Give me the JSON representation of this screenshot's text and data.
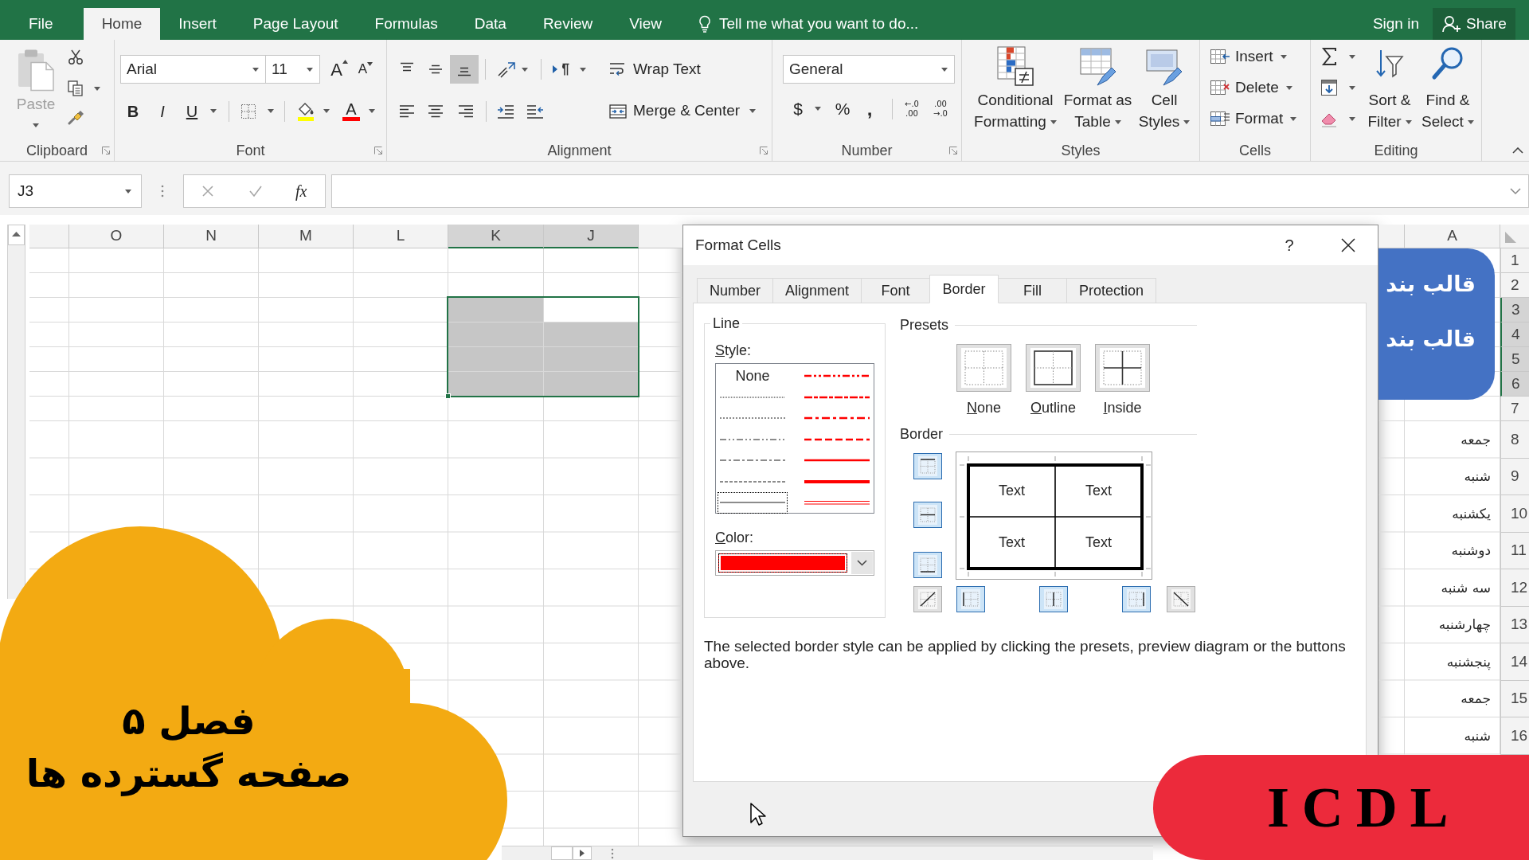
{
  "tabs": [
    {
      "label": "File",
      "selected": false
    },
    {
      "label": "Home",
      "selected": true
    },
    {
      "label": "Insert",
      "selected": false
    },
    {
      "label": "Page Layout",
      "selected": false
    },
    {
      "label": "Formulas",
      "selected": false
    },
    {
      "label": "Data",
      "selected": false
    },
    {
      "label": "Review",
      "selected": false
    },
    {
      "label": "View",
      "selected": false
    }
  ],
  "tell_me": {
    "placeholder": "Tell me what you want to do..."
  },
  "account": {
    "sign_in": "Sign in",
    "share": "Share"
  },
  "ribbon": {
    "clipboard": {
      "label": "Clipboard",
      "paste": {
        "label": "Paste",
        "disabled": true
      }
    },
    "font": {
      "label": "Font",
      "font_name": "Arial",
      "font_size": "11",
      "grow": "A",
      "shrink": "A",
      "styles": [
        {
          "kind": "bold",
          "label": "B"
        },
        {
          "kind": "italic",
          "label": "I"
        },
        {
          "kind": "underline",
          "label": "U"
        }
      ],
      "font_color": "A"
    },
    "alignment": {
      "label": "Alignment",
      "vertical": [
        {
          "kind": "top",
          "selected": false
        },
        {
          "kind": "middle",
          "selected": false
        },
        {
          "kind": "bottom",
          "selected": true
        }
      ],
      "wrap_text": "Wrap Text",
      "merge": "Merge & Center"
    },
    "number": {
      "label": "Number",
      "format": "General",
      "currency": "$",
      "percent": "%",
      "comma": ",",
      "decimals": [
        {
          "lines": [
            "←.0",
            ".00"
          ]
        },
        {
          "lines": [
            ".00",
            "→.0"
          ]
        }
      ]
    },
    "styles": {
      "label": "Styles",
      "buttons": [
        {
          "kind": "conditional_formatting",
          "lines": [
            "Conditional",
            "Formatting"
          ]
        },
        {
          "kind": "format_as_table",
          "lines": [
            "Format as",
            "Table"
          ]
        },
        {
          "kind": "cell_styles",
          "lines": [
            "Cell",
            "Styles"
          ]
        }
      ]
    },
    "cells": {
      "label": "Cells",
      "buttons": [
        {
          "kind": "insert",
          "label": "Insert"
        },
        {
          "kind": "delete",
          "label": "Delete"
        },
        {
          "kind": "format",
          "label": "Format"
        }
      ]
    },
    "editing": {
      "label": "Editing",
      "tools": [
        {
          "kind": "autosum"
        },
        {
          "kind": "fill"
        },
        {
          "kind": "clear"
        }
      ],
      "buttons": [
        {
          "kind": "sort_filter",
          "lines": [
            "Sort &",
            "Filter"
          ]
        },
        {
          "kind": "find_select",
          "lines": [
            "Find &",
            "Select"
          ]
        }
      ]
    }
  },
  "formula_bar": {
    "name_box": "J3",
    "function": "fx"
  },
  "sheet": {
    "columns": [
      {
        "label": "O",
        "selected": false
      },
      {
        "label": "N",
        "selected": false
      },
      {
        "label": "M",
        "selected": false
      },
      {
        "label": "L",
        "selected": false
      },
      {
        "label": "K",
        "selected": true
      },
      {
        "label": "J",
        "selected": true
      }
    ],
    "right_columns": [
      {
        "label": "A",
        "selected": false
      }
    ],
    "rows": [
      {
        "number": "1",
        "selected": false
      },
      {
        "number": "2",
        "selected": false
      },
      {
        "number": "3",
        "selected": true
      },
      {
        "number": "4",
        "selected": true
      },
      {
        "number": "5",
        "selected": true
      },
      {
        "number": "6",
        "selected": true
      },
      {
        "number": "7",
        "selected": false
      },
      {
        "number": "8",
        "selected": false,
        "column_a": "جمعه"
      },
      {
        "number": "9",
        "selected": false,
        "column_a": "شنبه"
      },
      {
        "number": "10",
        "selected": false,
        "column_a": "یکشنبه"
      },
      {
        "number": "11",
        "selected": false,
        "column_a": "دوشنبه"
      },
      {
        "number": "12",
        "selected": false,
        "column_a": "سه شنبه"
      },
      {
        "number": "13",
        "selected": false,
        "column_a": "چهارشنبه"
      },
      {
        "number": "14",
        "selected": false,
        "column_a": "پنجشنبه"
      },
      {
        "number": "15",
        "selected": false,
        "column_a": "جمعه"
      },
      {
        "number": "16",
        "selected": false,
        "column_a": "شنبه"
      }
    ],
    "shape": {
      "lines": [
        "قالب بند",
        "قالب بند"
      ]
    }
  },
  "dialog": {
    "title": "Format Cells",
    "help": "?",
    "tabs": [
      {
        "label": "Number",
        "selected": false
      },
      {
        "label": "Alignment",
        "selected": false
      },
      {
        "label": "Font",
        "selected": false
      },
      {
        "label": "Border",
        "selected": true
      },
      {
        "label": "Fill",
        "selected": false
      },
      {
        "label": "Protection",
        "selected": false
      }
    ],
    "line": {
      "label": "Line",
      "style_label": "Style:",
      "styles": [
        {
          "kind": "none",
          "label": "None",
          "selected": false
        },
        {
          "kind": "hair",
          "selected": false
        },
        {
          "kind": "dotted",
          "selected": false
        },
        {
          "kind": "dash_dot_dot",
          "selected": false
        },
        {
          "kind": "dash_dot",
          "selected": false
        },
        {
          "kind": "dashed",
          "selected": false
        },
        {
          "kind": "thin",
          "selected": true
        },
        {
          "kind": "medium_dash_dot_dot",
          "selected": false
        },
        {
          "kind": "slant_dash_dot",
          "selected": false
        },
        {
          "kind": "medium_dash_dot",
          "selected": false
        },
        {
          "kind": "medium_dashed",
          "selected": false
        },
        {
          "kind": "medium",
          "selected": false
        },
        {
          "kind": "thick",
          "selected": false
        },
        {
          "kind": "double",
          "selected": false
        }
      ],
      "color_label": "Color:",
      "color": "#ff0000"
    },
    "presets": {
      "label": "Presets",
      "items": [
        {
          "kind": "none",
          "label": "None"
        },
        {
          "kind": "outline",
          "label": "Outline"
        },
        {
          "kind": "inside",
          "label": "Inside"
        }
      ]
    },
    "border": {
      "label": "Border",
      "buttons": [
        {
          "kind": "top",
          "on": true
        },
        {
          "kind": "inside_horizontal",
          "on": true
        },
        {
          "kind": "bottom",
          "on": true
        },
        {
          "kind": "diagonal_up",
          "on": false
        },
        {
          "kind": "left",
          "on": true
        },
        {
          "kind": "inside_vertical",
          "on": true
        },
        {
          "kind": "right",
          "on": true
        },
        {
          "kind": "diagonal_down",
          "on": false
        }
      ],
      "preview_texts": [
        "Text",
        "Text",
        "Text",
        "Text"
      ]
    },
    "hint": "The selected border style can be applied by clicking the presets, preview diagram or the buttons above."
  },
  "overlay": {
    "chapter": "فصل ۵",
    "subject": "صفحه گسترده ها",
    "course": "ICDL"
  }
}
